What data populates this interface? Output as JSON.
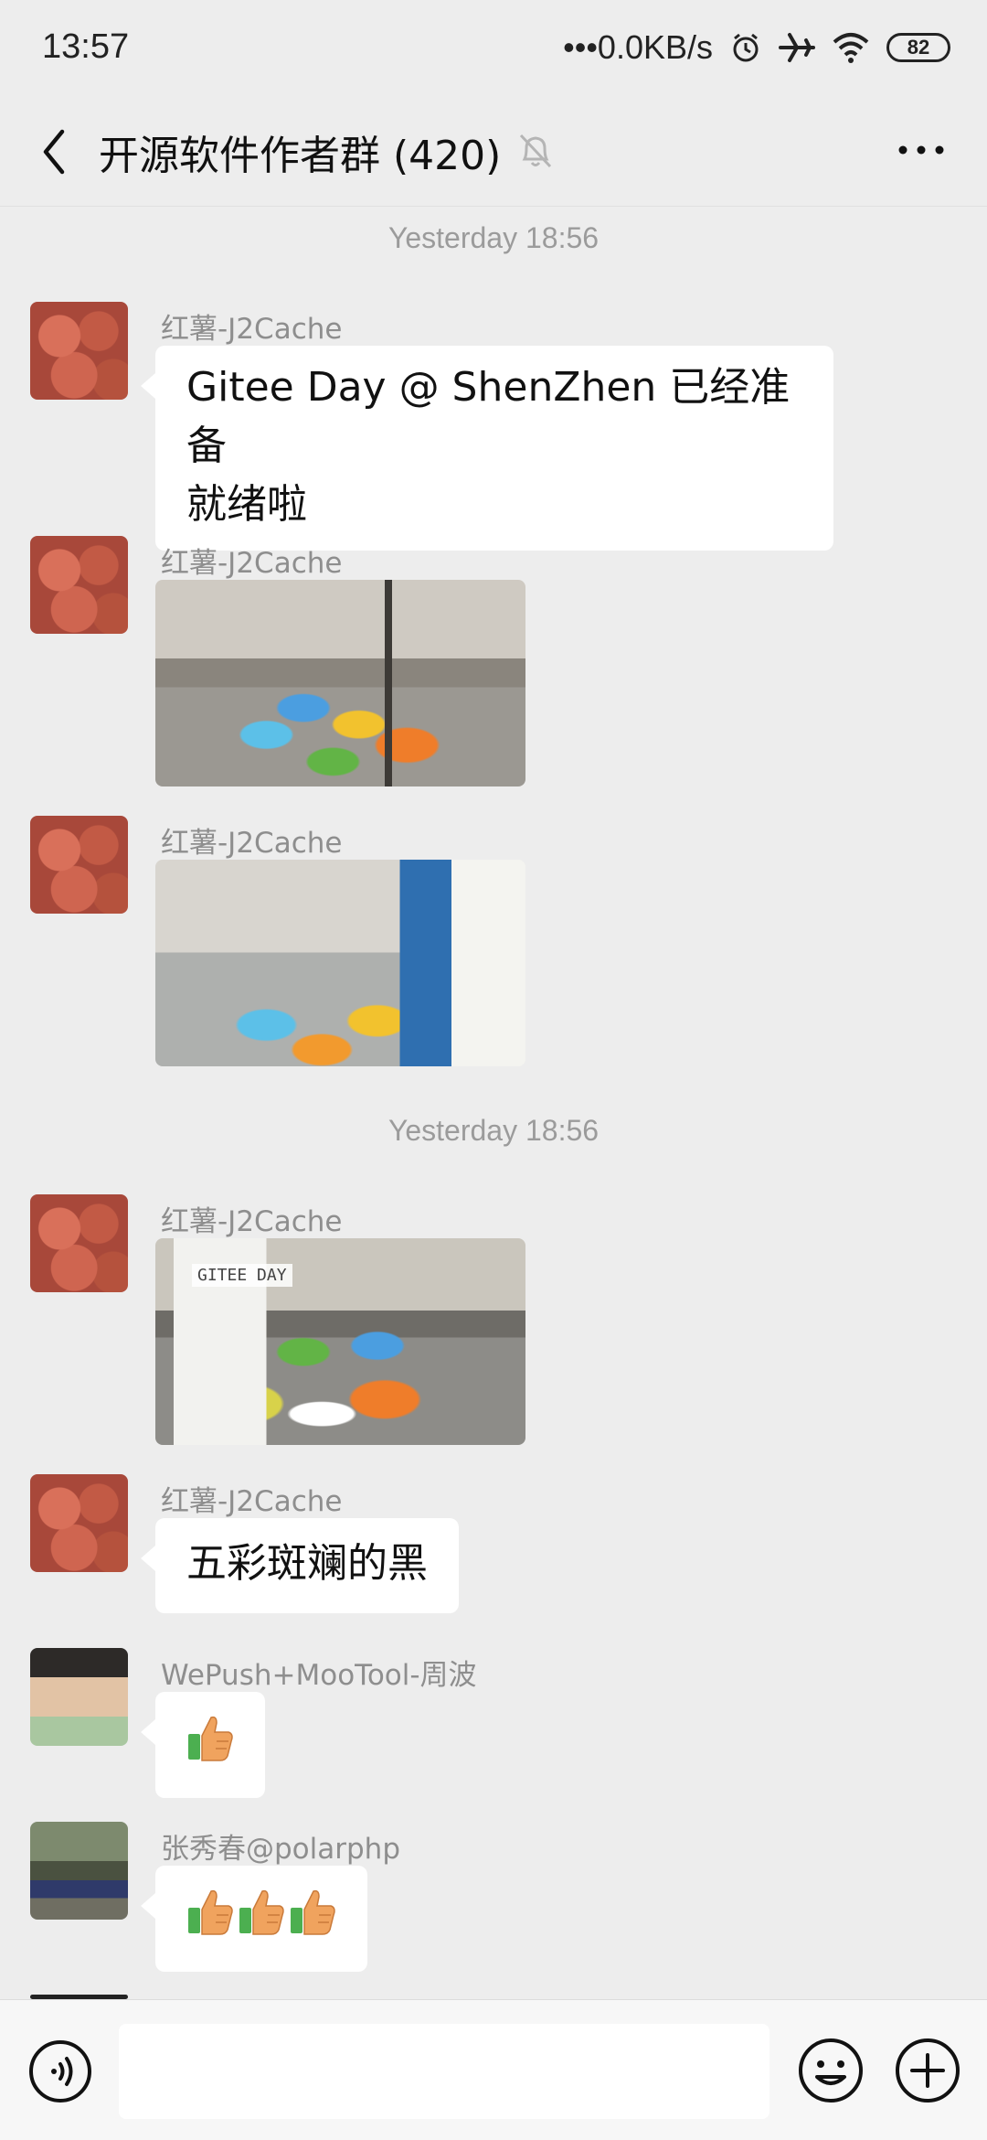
{
  "status_bar": {
    "time": "13:57",
    "network": "•••0.0KB/s",
    "battery": "82"
  },
  "header": {
    "title": "开源软件作者群 (420)"
  },
  "timestamps": [
    "Yesterday 18:56",
    "Yesterday 18:56"
  ],
  "messages": [
    {
      "sender": "红薯-J2Cache",
      "type": "text",
      "text_line1": "Gitee Day @ ShenZhen 已经准备",
      "text_line2": "就绪啦"
    },
    {
      "sender": "红薯-J2Cache",
      "type": "image"
    },
    {
      "sender": "红薯-J2Cache",
      "type": "image"
    },
    {
      "sender": "红薯-J2Cache",
      "type": "image",
      "caption": "GITEE DAY"
    },
    {
      "sender": "红薯-J2Cache",
      "type": "text",
      "text": "五彩斑斓的黑"
    },
    {
      "sender": "WePush+MooTool-周波",
      "type": "emoji",
      "emoji": "thumbs-up",
      "count": 1
    },
    {
      "sender": "张秀春@polarphp",
      "type": "emoji",
      "emoji": "thumbs-up",
      "count": 3
    }
  ],
  "input": {
    "value": ""
  },
  "colors": {
    "background": "#ededed",
    "bubble": "#ffffff",
    "sender_text": "#8e8e8e",
    "timestamp_text": "#9b9b9b"
  }
}
